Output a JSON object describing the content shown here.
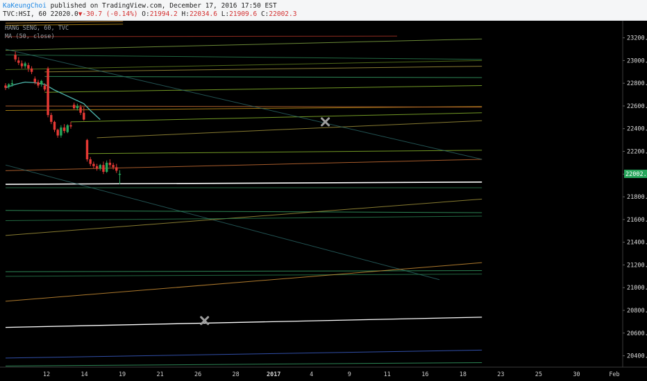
{
  "header": {
    "author": "KaKeungChoi",
    "published": "published on TradingView.com, December 17, 2016 17:50 EST",
    "symbol": "TVC:HSI, 60",
    "last": "22020.0",
    "change": "-30.7 (-0.14%)",
    "open_label": "O:",
    "open": "21994.2",
    "high_label": "H:",
    "high": "22034.6",
    "low_label": "L:",
    "low": "21909.6",
    "close_label": "C:",
    "close": "22002.3",
    "arrow_icon": "triangle-down-icon"
  },
  "legend": {
    "line1": "HANG SENG, 60, TVC",
    "line2": "MA (50, close)"
  },
  "chart_data": {
    "type": "candlestick",
    "title": "HANG SENG, 60, TVC",
    "y_axis": {
      "ylim": [
        20300,
        23350
      ],
      "ticks": [
        20400,
        20600,
        20800,
        21000,
        21200,
        21400,
        21600,
        21800,
        22000,
        22200,
        22400,
        22600,
        22800,
        23000,
        23200
      ],
      "tick_labels": [
        "20400.0",
        "20600.0",
        "20800.0",
        "21000.0",
        "21200.0",
        "21400.0",
        "21600.0",
        "21800.0",
        "22000.0",
        "22200.0",
        "22400.0",
        "22600.0",
        "22800.0",
        "23000.0",
        "23200.0"
      ],
      "side": "right"
    },
    "x_axis": {
      "labels": [
        "12",
        "14",
        "19",
        "21",
        "26",
        "28",
        "2017",
        "4",
        "9",
        "11",
        "16",
        "18",
        "23",
        "25",
        "30",
        "Feb"
      ]
    },
    "price_label": {
      "value": 22002.3,
      "text": "22002.3",
      "color": "#26a65b"
    },
    "candles": [
      {
        "o": 22780,
        "h": 22800,
        "l": 22740,
        "c": 22760
      },
      {
        "o": 22770,
        "h": 22800,
        "l": 22750,
        "c": 22790
      },
      {
        "o": 22790,
        "h": 22830,
        "l": 22770,
        "c": 22800
      },
      {
        "o": 23050,
        "h": 23080,
        "l": 22990,
        "c": 23010
      },
      {
        "o": 23000,
        "h": 23030,
        "l": 22960,
        "c": 22980
      },
      {
        "o": 22975,
        "h": 23000,
        "l": 22930,
        "c": 22950
      },
      {
        "o": 22950,
        "h": 22990,
        "l": 22930,
        "c": 22975
      },
      {
        "o": 22960,
        "h": 22980,
        "l": 22900,
        "c": 22930
      },
      {
        "o": 22930,
        "h": 22950,
        "l": 22880,
        "c": 22900
      },
      {
        "o": 22840,
        "h": 22860,
        "l": 22790,
        "c": 22810
      },
      {
        "o": 22810,
        "h": 22830,
        "l": 22760,
        "c": 22780
      },
      {
        "o": 22790,
        "h": 22830,
        "l": 22770,
        "c": 22820
      },
      {
        "o": 22780,
        "h": 22800,
        "l": 22730,
        "c": 22745
      },
      {
        "o": 22930,
        "h": 22945,
        "l": 22500,
        "c": 22520
      },
      {
        "o": 22520,
        "h": 22540,
        "l": 22440,
        "c": 22460
      },
      {
        "o": 22460,
        "h": 22470,
        "l": 22370,
        "c": 22390
      },
      {
        "o": 22390,
        "h": 22400,
        "l": 22320,
        "c": 22340
      },
      {
        "o": 22340,
        "h": 22430,
        "l": 22320,
        "c": 22410
      },
      {
        "o": 22410,
        "h": 22440,
        "l": 22360,
        "c": 22380
      },
      {
        "o": 22370,
        "h": 22440,
        "l": 22360,
        "c": 22430
      },
      {
        "o": 22430,
        "h": 22460,
        "l": 22400,
        "c": 22420
      },
      {
        "o": 22610,
        "h": 22630,
        "l": 22570,
        "c": 22580
      },
      {
        "o": 22580,
        "h": 22620,
        "l": 22560,
        "c": 22600
      },
      {
        "o": 22590,
        "h": 22610,
        "l": 22520,
        "c": 22540
      },
      {
        "o": 22540,
        "h": 22590,
        "l": 22470,
        "c": 22480
      },
      {
        "o": 22300,
        "h": 22310,
        "l": 22110,
        "c": 22130
      },
      {
        "o": 22130,
        "h": 22150,
        "l": 22070,
        "c": 22090
      },
      {
        "o": 22090,
        "h": 22110,
        "l": 22050,
        "c": 22070
      },
      {
        "o": 22070,
        "h": 22090,
        "l": 22030,
        "c": 22050
      },
      {
        "o": 22050,
        "h": 22090,
        "l": 22030,
        "c": 22080
      },
      {
        "o": 22080,
        "h": 22110,
        "l": 22000,
        "c": 22020
      },
      {
        "o": 22020,
        "h": 22120,
        "l": 22010,
        "c": 22100
      },
      {
        "o": 22100,
        "h": 22130,
        "l": 22060,
        "c": 22080
      },
      {
        "o": 22080,
        "h": 22100,
        "l": 22040,
        "c": 22060
      },
      {
        "o": 22060,
        "h": 22090,
        "l": 22010,
        "c": 22030
      },
      {
        "o": 21994.2,
        "h": 22034.6,
        "l": 21909.6,
        "c": 22002.3
      }
    ],
    "ma": {
      "name": "MA (50, close)",
      "color": "#4db6ac",
      "points": [
        [
          0,
          22760
        ],
        [
          3,
          22790
        ],
        [
          6,
          22810
        ],
        [
          9,
          22805
        ],
        [
          12,
          22790
        ],
        [
          15,
          22740
        ],
        [
          18,
          22700
        ],
        [
          21,
          22660
        ],
        [
          24,
          22620
        ],
        [
          26,
          22560
        ],
        [
          29,
          22480
        ]
      ]
    },
    "drawn_lines": [
      {
        "x1": 0,
        "y1": 23330,
        "x2": 36,
        "y2": 23345,
        "color": "#e8a33c"
      },
      {
        "x1": 0,
        "y1": 23310,
        "x2": 36,
        "y2": 23320,
        "color": "#d4a017"
      },
      {
        "x1": 0,
        "y1": 23210,
        "x2": 120,
        "y2": 23215,
        "color": "#c0392b"
      },
      {
        "x1": 0,
        "y1": 23090,
        "x2": 146,
        "y2": 23190,
        "color": "#8fb84a"
      },
      {
        "x1": 0,
        "y1": 23050,
        "x2": 146,
        "y2": 23010,
        "color": "#2e8b57"
      },
      {
        "x1": 12,
        "y1": 22900,
        "x2": 146,
        "y2": 22950,
        "color": "#b5a642"
      },
      {
        "x1": 12,
        "y1": 22860,
        "x2": 146,
        "y2": 22850,
        "color": "#3cb371"
      },
      {
        "x1": 12,
        "y1": 22720,
        "x2": 146,
        "y2": 22780,
        "color": "#9acd32"
      },
      {
        "x1": 0,
        "y1": 22560,
        "x2": 146,
        "y2": 22595,
        "color": "#d4a017"
      },
      {
        "x1": 0,
        "y1": 22600,
        "x2": 146,
        "y2": 22590,
        "color": "#e07b39"
      },
      {
        "x1": 20,
        "y1": 22460,
        "x2": 146,
        "y2": 22540,
        "color": "#9acd32"
      },
      {
        "x1": 28,
        "y1": 22320,
        "x2": 146,
        "y2": 22470,
        "color": "#b5a642"
      },
      {
        "x1": 25,
        "y1": 22180,
        "x2": 146,
        "y2": 22210,
        "color": "#9acd32"
      },
      {
        "x1": 0,
        "y1": 22030,
        "x2": 146,
        "y2": 22130,
        "color": "#e07b39"
      },
      {
        "x1": 0,
        "y1": 23100,
        "x2": 146,
        "y2": 22130,
        "color": "#2e6f6f"
      },
      {
        "x1": 0,
        "y1": 21910,
        "x2": 146,
        "y2": 21930,
        "color": "#ffffff",
        "width": 1.6
      },
      {
        "x1": 0,
        "y1": 21880,
        "x2": 146,
        "y2": 21880,
        "color": "#2e8b57"
      },
      {
        "x1": 0,
        "y1": 22080,
        "x2": 133,
        "y2": 21070,
        "color": "#2e6f6f"
      },
      {
        "x1": 0,
        "y1": 21680,
        "x2": 146,
        "y2": 21660,
        "color": "#3cb371"
      },
      {
        "x1": 0,
        "y1": 21460,
        "x2": 146,
        "y2": 21780,
        "color": "#b5a642"
      },
      {
        "x1": 0,
        "y1": 21590,
        "x2": 146,
        "y2": 21630,
        "color": "#2e8b57"
      },
      {
        "x1": 0,
        "y1": 21140,
        "x2": 146,
        "y2": 21150,
        "color": "#3cb371"
      },
      {
        "x1": 0,
        "y1": 21100,
        "x2": 146,
        "y2": 21120,
        "color": "#2e8b57"
      },
      {
        "x1": 0,
        "y1": 20880,
        "x2": 146,
        "y2": 21220,
        "color": "#e8a33c"
      },
      {
        "x1": 0,
        "y1": 20650,
        "x2": 146,
        "y2": 20740,
        "color": "#ffffff",
        "width": 1.3
      },
      {
        "x1": 0,
        "y1": 20380,
        "x2": 146,
        "y2": 20450,
        "color": "#4169e1"
      },
      {
        "x1": 0,
        "y1": 20310,
        "x2": 146,
        "y2": 20340,
        "color": "#3cb371"
      },
      {
        "x1": 0,
        "y1": 22920,
        "x2": 146,
        "y2": 23000,
        "color": "#6b8e23"
      }
    ],
    "markers": [
      {
        "x": 98,
        "y": 22460,
        "label": "x-marker"
      },
      {
        "x": 61,
        "y": 20710,
        "label": "x-marker"
      }
    ],
    "colors": {
      "up": "#26a65b",
      "down": "#e53935",
      "background": "#000000"
    }
  }
}
